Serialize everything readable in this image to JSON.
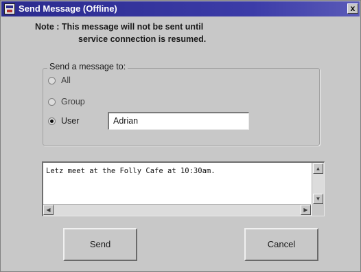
{
  "window": {
    "title": "Send Message (Offline)",
    "close_label": "x"
  },
  "note": {
    "line1": "Note : This message will not be sent until",
    "line2": "service connection is resumed."
  },
  "recipient": {
    "legend": "Send a message to:",
    "options": [
      {
        "label": "All",
        "checked": false
      },
      {
        "label": "Group",
        "checked": false
      },
      {
        "label": "User",
        "checked": true
      }
    ],
    "user_value": "Adrian"
  },
  "message": {
    "text": "Letz meet at the Folly Cafe at 10:30am."
  },
  "buttons": {
    "send": "Send",
    "cancel": "Cancel"
  },
  "colors": {
    "titlebar": "#2b2b8e",
    "window_bg": "#c8c8c8"
  }
}
